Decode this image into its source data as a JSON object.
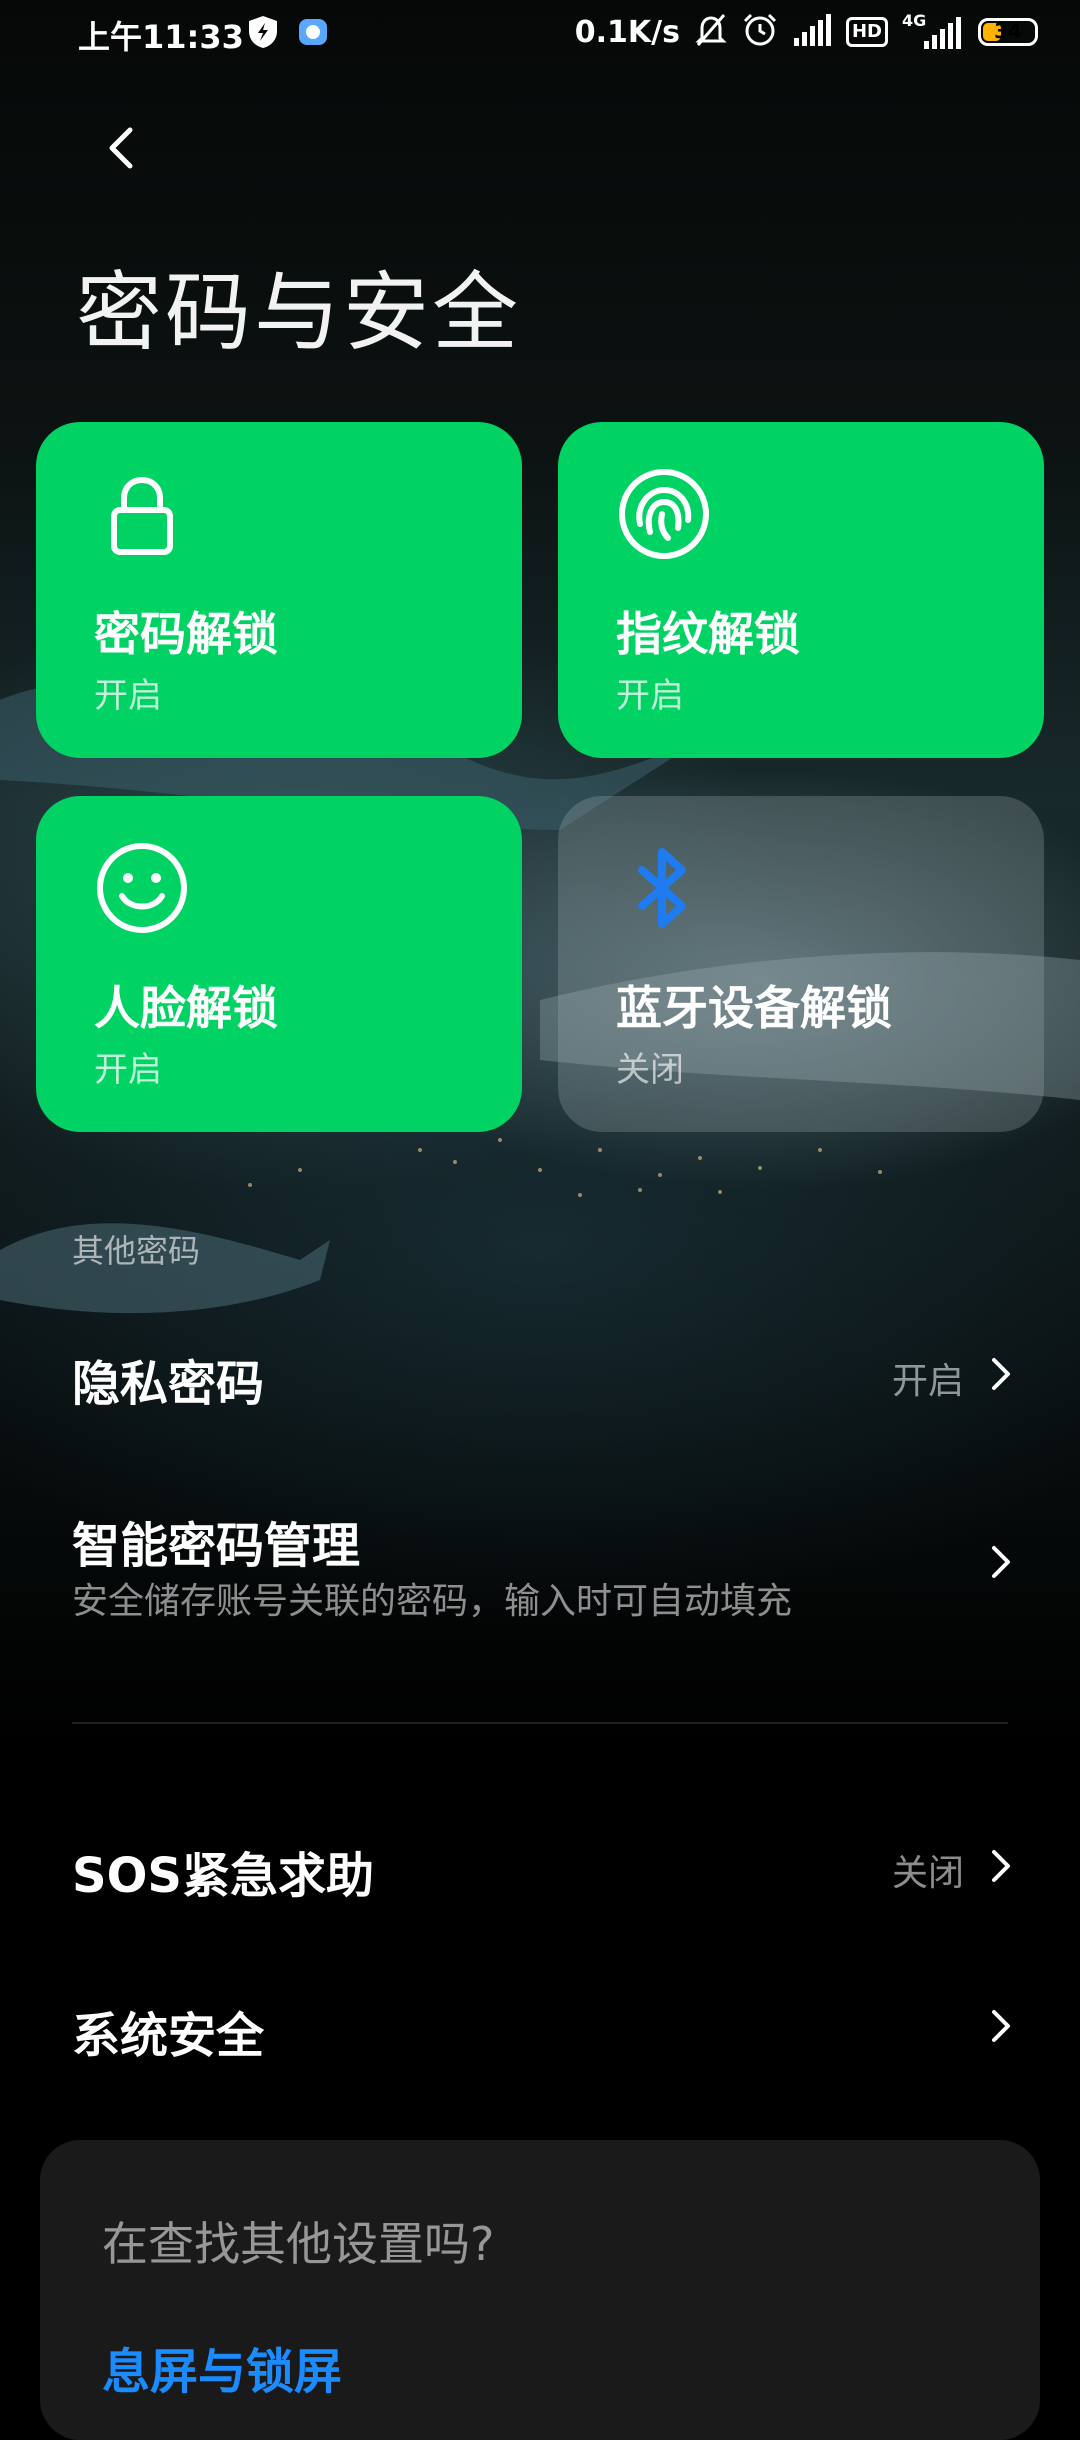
{
  "status_bar": {
    "time": "上午11:33",
    "speed": "0.1K/s",
    "network_type": "4G",
    "hd_label": "HD",
    "battery": "34"
  },
  "header": {
    "title": "密码与安全"
  },
  "tiles": [
    {
      "label": "密码解锁",
      "status": "开启",
      "icon": "lock-icon",
      "active": true
    },
    {
      "label": "指纹解锁",
      "status": "开启",
      "icon": "fingerprint-icon",
      "active": true
    },
    {
      "label": "人脸解锁",
      "status": "开启",
      "icon": "smiley-face-icon",
      "active": true
    },
    {
      "label": "蓝牙设备解锁",
      "status": "关闭",
      "icon": "bluetooth-icon",
      "active": false
    }
  ],
  "other_passwords": {
    "header": "其他密码",
    "privacy": {
      "label": "隐私密码",
      "value": "开启"
    },
    "smart": {
      "label": "智能密码管理",
      "desc": "安全储存账号关联的密码，输入时可自动填充"
    }
  },
  "sos": {
    "label": "SOS紧急求助",
    "value": "关闭"
  },
  "system_security": {
    "label": "系统安全"
  },
  "suggestion": {
    "title": "在查找其他设置吗?",
    "link": "息屏与锁屏"
  },
  "colors": {
    "accent_green": "#00d264",
    "link_blue": "#1a8cff",
    "bluetooth_blue": "#1e7bf0"
  }
}
